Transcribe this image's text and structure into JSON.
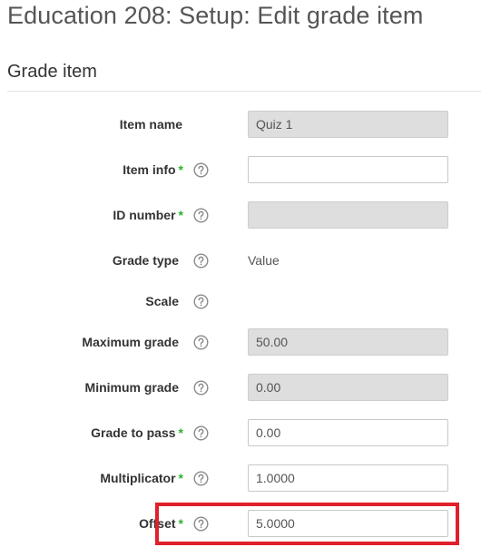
{
  "page": {
    "title": "Education 208: Setup: Edit grade item"
  },
  "section": {
    "title": "Grade item"
  },
  "form": {
    "rows": [
      {
        "label": "Item name",
        "required": false,
        "help": false,
        "type": "input",
        "disabled": true,
        "value": "Quiz 1"
      },
      {
        "label": "Item info",
        "required": true,
        "help": true,
        "type": "input",
        "disabled": false,
        "value": ""
      },
      {
        "label": "ID number",
        "required": true,
        "help": true,
        "type": "input",
        "disabled": true,
        "value": ""
      },
      {
        "label": "Grade type",
        "required": false,
        "help": true,
        "type": "static",
        "disabled": false,
        "value": "Value"
      },
      {
        "label": "Scale",
        "required": false,
        "help": true,
        "type": "none",
        "disabled": false,
        "value": ""
      },
      {
        "label": "Maximum grade",
        "required": false,
        "help": true,
        "type": "input",
        "disabled": true,
        "value": "50.00"
      },
      {
        "label": "Minimum grade",
        "required": false,
        "help": true,
        "type": "input",
        "disabled": true,
        "value": "0.00"
      },
      {
        "label": "Grade to pass",
        "required": true,
        "help": true,
        "type": "input",
        "disabled": false,
        "value": "0.00"
      },
      {
        "label": "Multiplicator",
        "required": true,
        "help": true,
        "type": "input",
        "disabled": false,
        "value": "1.0000"
      },
      {
        "label": "Offset",
        "required": true,
        "help": true,
        "type": "input",
        "disabled": false,
        "value": "5.0000"
      }
    ],
    "required_marker": "*",
    "help_icon": "question-circle-icon"
  },
  "highlight": {
    "target": "Offset",
    "color": "#e0202a"
  },
  "colors": {
    "required": "#2db12d",
    "disabled_field": "#dedede"
  }
}
